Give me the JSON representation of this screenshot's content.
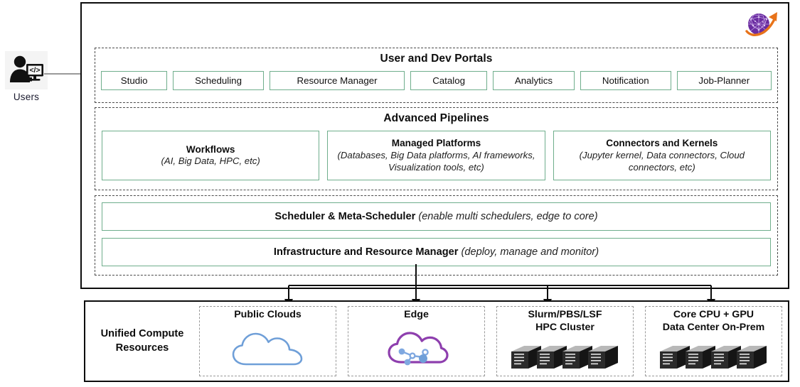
{
  "actor": {
    "label": "Users",
    "icon": "user-with-code-monitor-icon"
  },
  "platform": {
    "logo_icon": "network-globe-orange-arrow-logo",
    "layers": [
      {
        "id": "portals",
        "title": "User and Dev Portals",
        "items": [
          "Studio",
          "Scheduling",
          "Resource Manager",
          "Catalog",
          "Analytics",
          "Notification",
          "Job-Planner"
        ]
      },
      {
        "id": "pipelines",
        "title": "Advanced Pipelines",
        "boxes": [
          {
            "title": "Workflows",
            "subtitle": "(AI, Big Data, HPC, etc)"
          },
          {
            "title": "Managed Platforms",
            "subtitle": "(Databases, Big Data platforms, AI frameworks, Visualization tools, etc)"
          },
          {
            "title": "Connectors and Kernels",
            "subtitle": "(Jupyter kernel, Data connectors, Cloud connectors, etc)"
          }
        ]
      },
      {
        "id": "infrastructure",
        "title": "",
        "bars": [
          {
            "title": "Scheduler & Meta-Scheduler",
            "note": "(enable multi schedulers, edge to core)"
          },
          {
            "title": "Infrastructure and Resource Manager",
            "note": "(deploy, manage and monitor)"
          }
        ]
      }
    ]
  },
  "compute": {
    "title": "Unified\nCompute\nResources",
    "cells": [
      {
        "label": "Public Clouds",
        "icon": "blue-cloud-outline-icon"
      },
      {
        "label": "Edge",
        "icon": "purple-cloud-network-nodes-icon"
      },
      {
        "label": "Slurm/PBS/LSF\nHPC Cluster",
        "icon": "server-rack-cluster-icon"
      },
      {
        "label": "Core CPU + GPU\nData Center On-Prem",
        "icon": "server-rack-cluster-icon"
      }
    ]
  },
  "colors": {
    "green_border": "#6fae8c",
    "outer_border": "#0c0c0c",
    "dashed_layer": "#4a4a4a",
    "dashed_cell": "#9a9a9a",
    "cloud_blue": "#6f9fd8",
    "edge_purple": "#8e3fae",
    "edge_node_blue": "#7fa8e0",
    "logo_purple": "#6a2ca0",
    "logo_orange": "#e8731a",
    "connector_gray": "#8c8c8c"
  }
}
